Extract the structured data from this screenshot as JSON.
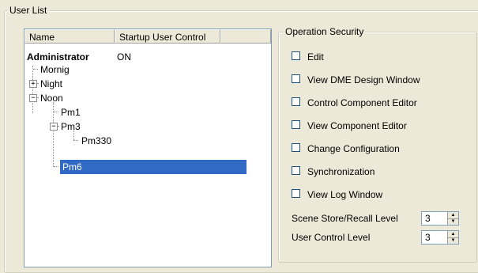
{
  "user_list": {
    "title": "User List",
    "columns": [
      "Name",
      "Startup User Control"
    ],
    "users": [
      {
        "label": "Administrator",
        "startup": "ON"
      },
      {
        "label": "Mornig"
      },
      {
        "label": "Night"
      },
      {
        "label": "Noon"
      },
      {
        "label": "Pm1"
      },
      {
        "label": "Pm3"
      },
      {
        "label": "Pm330"
      },
      {
        "label": "Pm6"
      }
    ]
  },
  "operation_security": {
    "title": "Operation Security",
    "checkboxes": [
      {
        "label": "Edit",
        "checked": false
      },
      {
        "label": "View DME Design Window",
        "checked": false
      },
      {
        "label": "Control Component Editor",
        "checked": false
      },
      {
        "label": "View Component Editor",
        "checked": false
      },
      {
        "label": "Change Configuration",
        "checked": false
      },
      {
        "label": "Synchronization",
        "checked": false
      },
      {
        "label": "View Log Window",
        "checked": false
      }
    ],
    "scene_store_recall_level": {
      "label": "Scene Store/Recall Level",
      "value": "3"
    },
    "user_control_level": {
      "label": "User Control Level",
      "value": "3"
    }
  },
  "icons": {
    "expand": "plus-box-icon",
    "collapse": "minus-box-icon",
    "spin_up": "up-arrow-icon",
    "spin_down": "down-arrow-icon"
  }
}
